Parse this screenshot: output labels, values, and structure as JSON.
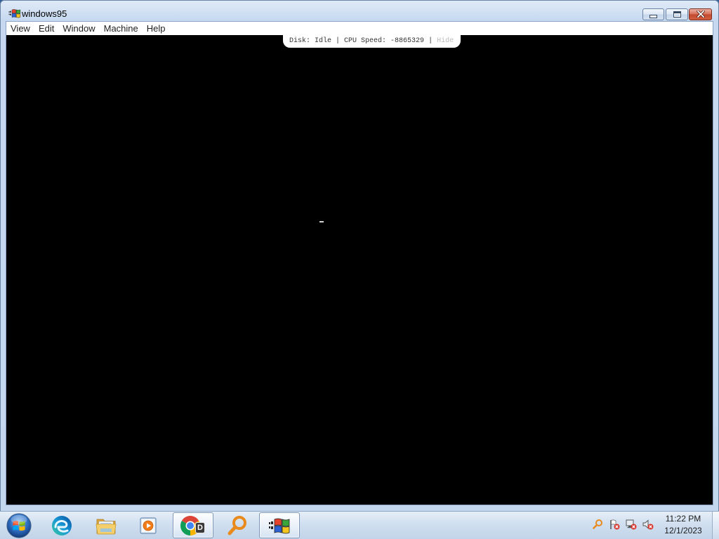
{
  "window": {
    "title": "windows95",
    "title_icon": "windows95-app-icon",
    "minimize_icon": "minimize-icon",
    "maximize_icon": "maximize-icon",
    "close_icon": "close-icon"
  },
  "menu": [
    {
      "label": "View"
    },
    {
      "label": "Edit"
    },
    {
      "label": "Window"
    },
    {
      "label": "Machine"
    },
    {
      "label": "Help"
    }
  ],
  "status_bar": {
    "disk": "Disk: Idle",
    "separator": "|",
    "cpu_speed": "CPU Speed: -8865329",
    "hide_label": "Hide"
  },
  "taskbar": {
    "start_icon": "windows-start-orb-icon",
    "items": [
      {
        "icon": "edge-icon",
        "active": false
      },
      {
        "icon": "file-explorer-icon",
        "active": false
      },
      {
        "icon": "media-player-icon",
        "active": false
      },
      {
        "icon": "chrome-icon",
        "badge": "D",
        "active": true
      },
      {
        "icon": "search-magnifier-icon",
        "active": false
      },
      {
        "icon": "windows95-app-icon",
        "active": true
      }
    ],
    "tray": {
      "icons": [
        "magnifier-icon",
        "action-center-flag-error-icon",
        "network-disconnected-icon",
        "volume-muted-icon"
      ],
      "time": "11:22 PM",
      "date": "12/1/2023"
    }
  },
  "colors": {
    "titlebar": "#c3d7ef",
    "menubar": "#ffffff",
    "screen": "#000000",
    "status_pill": "#ffffff",
    "status_text": "#333333",
    "status_hide": "#bdbdbd",
    "close_button": "#c24a2f",
    "taskbar": "#d2e0f0"
  }
}
